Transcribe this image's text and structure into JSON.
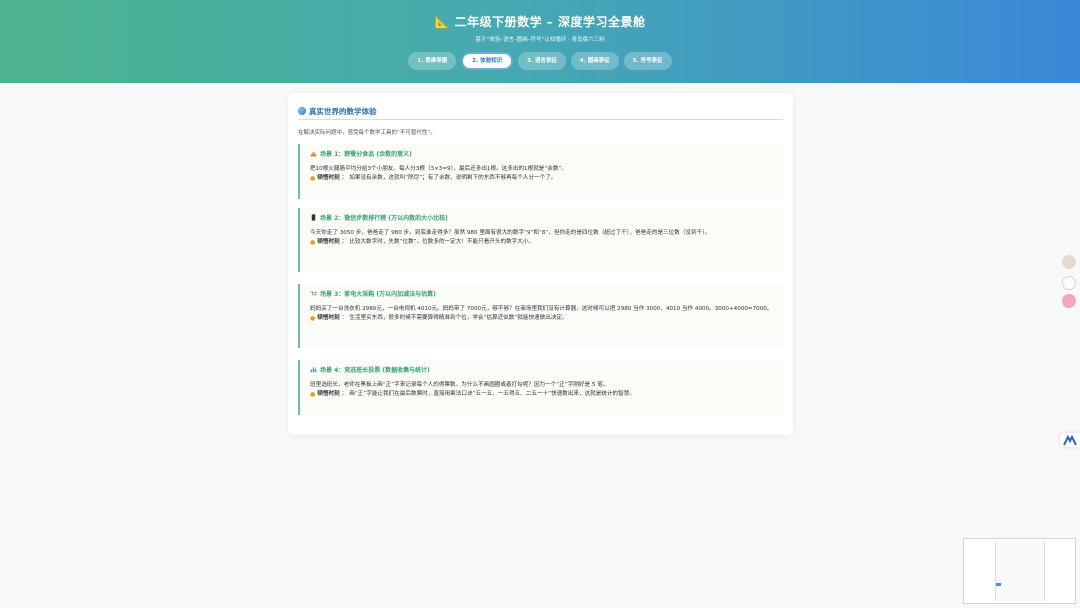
{
  "header": {
    "title": "📐 二年级下册数学 – 深度学习全景舱",
    "subtitle": "基于“体验–语言–图画–符号”认知循环 · 青岛版六三制",
    "tabs": [
      {
        "label": "1. 思维导图",
        "active": false
      },
      {
        "label": "2. 体验知识",
        "active": true
      },
      {
        "label": "3. 语言表征",
        "active": false
      },
      {
        "label": "4. 图画表征",
        "active": false
      },
      {
        "label": "5. 符号表征",
        "active": false
      }
    ]
  },
  "section": {
    "title": "真实世界的数学体验",
    "intro": "在解决实际问题中，感受每个数学工具的“不可替代性”。"
  },
  "scenes": [
    {
      "icon": "bread-icon",
      "heading": "场景 1：野餐分食品 (余数的意义)",
      "body": "把10根火腿肠平均分给3个小朋友。每人分3根（3×3=9），最后还多出1根。这多出的1根就是“余数”。",
      "tip_label": "顿悟时刻",
      "tip_text": "如果没有余数，这就叫“除尽”；有了余数，说明剩下的东西不够再每个人分一个了。"
    },
    {
      "icon": "phone-icon",
      "heading": "场景 2：微信步数排行榜 (万以内数的大小比较)",
      "body": "今天你走了 3050 步，爸爸走了 980 步。到底谁走得多？虽然 980 里面有很大的数字“9”和“8”，但你走的是四位数（超过了千），爸爸走的是三位数（没到千）。",
      "tip_label": "顿悟时刻",
      "tip_text": "比较大数字时，先数“位数”。位数多的一定大！不能只看开头的数字大小。"
    },
    {
      "icon": "shopping-icon",
      "heading": "场景 3：家电大采购 (万以内加减法与估算)",
      "body": "妈妈买了一台洗衣机 2980元，一台电视机 4010元。妈妈带了 7000元，够不够？在商场里我们没有计算器，这时候可以把 2980 当作 3000，4010 当作 4000。3000+4000=7000。",
      "tip_label": "顿悟时刻",
      "tip_text": "生活里买东西，很多时候不需要算得精准到个位，学会“估算近似数”就能快速做出决定。"
    },
    {
      "icon": "chart-icon",
      "heading": "场景 4：竞选班长投票 (数据收集与统计)",
      "body": "班里选班长，老师在黑板上画“正”字来记录每个人的得票数。为什么不画圆圈或者打勾呢？因为一个“正”字刚好是 5 笔。",
      "tip_label": "顿悟时刻",
      "tip_text": "画“正”字能让我们在最后数票时，直接用乘法口诀“五一五、一五得五、二五一十”快速数出来，这就是统计的智慧。"
    }
  ],
  "colors": {
    "accent": "#3aa17a",
    "title_blue": "#2d6fa8",
    "header_start": "#4db38e",
    "header_end": "#3a88d8"
  }
}
